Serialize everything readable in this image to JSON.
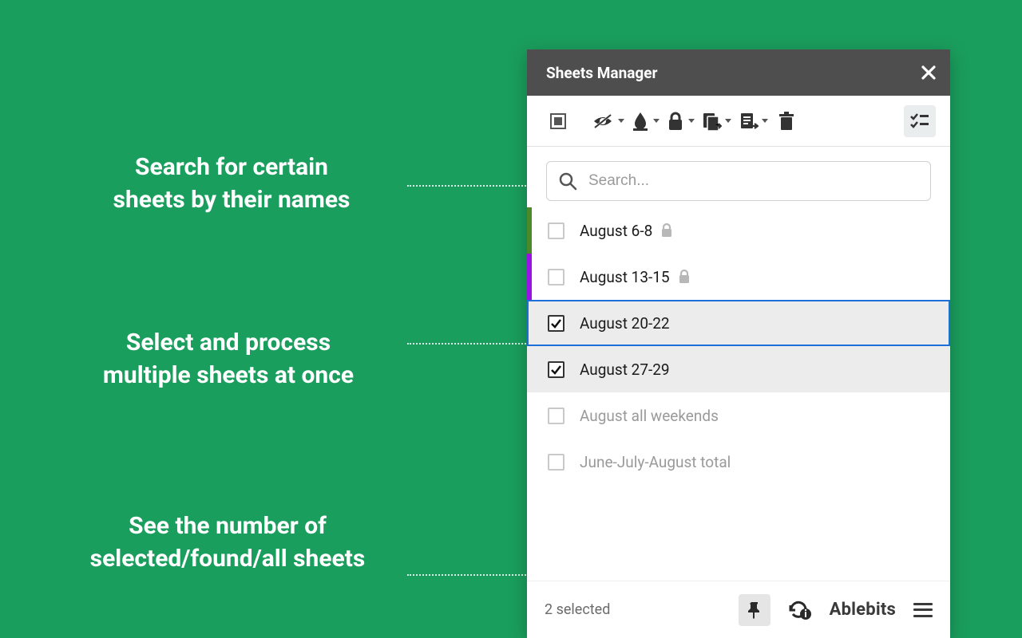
{
  "header": {
    "title": "Sheets Manager"
  },
  "search": {
    "placeholder": "Search..."
  },
  "callouts": {
    "search": "Search for certain\nsheets by their names",
    "select": "Select and process\nmultiple sheets at once",
    "status": "See the number of\nselected/found/all sheets"
  },
  "sheets": [
    {
      "label": "August 6-8",
      "checked": false,
      "locked": true,
      "lead": "#4a8a2a",
      "selected": false,
      "active": false,
      "muted": false
    },
    {
      "label": "August 13-15",
      "checked": false,
      "locked": true,
      "lead": "#9b12e6",
      "selected": false,
      "active": false,
      "muted": false
    },
    {
      "label": "August 20-22",
      "checked": true,
      "locked": false,
      "lead": "transparent",
      "selected": true,
      "active": true,
      "muted": false
    },
    {
      "label": "August 27-29",
      "checked": true,
      "locked": false,
      "lead": "transparent",
      "selected": true,
      "active": false,
      "muted": false
    },
    {
      "label": "August all weekends",
      "checked": false,
      "locked": false,
      "lead": "transparent",
      "selected": false,
      "active": false,
      "muted": true
    },
    {
      "label": "June-July-August total",
      "checked": false,
      "locked": false,
      "lead": "transparent",
      "selected": false,
      "active": false,
      "muted": true
    }
  ],
  "status": {
    "text": "2 selected",
    "brand": "Ablebits"
  }
}
